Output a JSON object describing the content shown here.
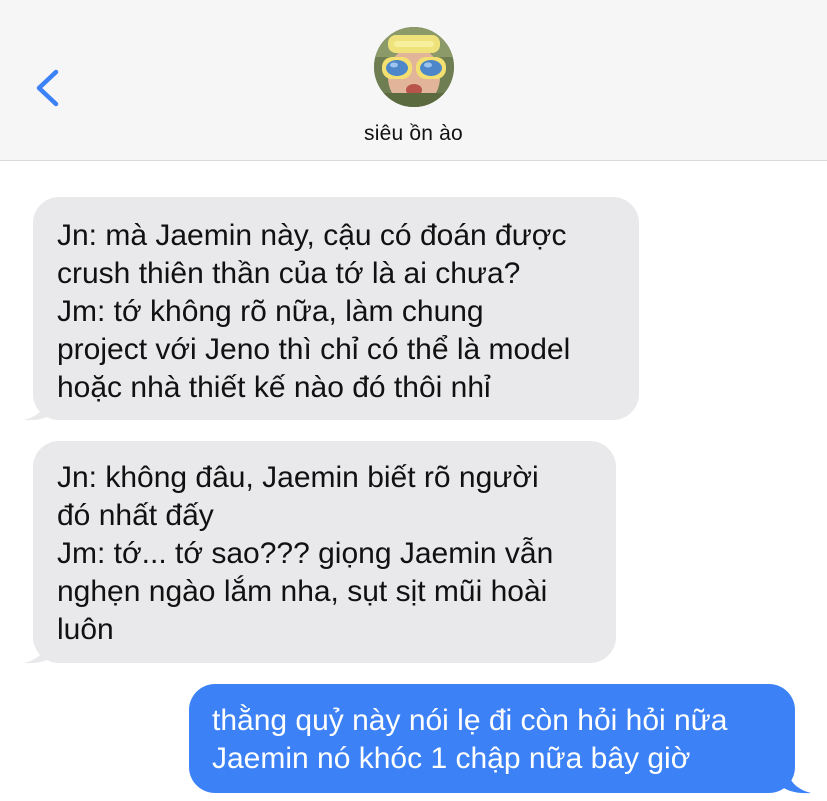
{
  "header": {
    "contact_name": "siêu ồn ào",
    "back_icon": "chevron-left-icon",
    "avatar": "contact-avatar"
  },
  "colors": {
    "header_bg": "#f6f6f6",
    "accent": "#3c82f6",
    "incoming_bubble": "#e9e9eb",
    "outgoing_bubble": "#3c82f6"
  },
  "messages": [
    {
      "direction": "incoming",
      "lines": [
        "Jn: mà Jaemin này, cậu có đoán được",
        "crush thiên thần của tớ là ai chưa?",
        "Jm: tớ không rõ nữa, làm chung",
        "project với Jeno thì chỉ có thể là model",
        "hoặc nhà thiết kế nào đó thôi nhỉ"
      ]
    },
    {
      "direction": "incoming",
      "lines": [
        "Jn: không đâu, Jaemin biết rõ người",
        "đó nhất đấy",
        "Jm: tớ... tớ sao??? giọng Jaemin vẫn",
        "nghẹn ngào lắm nha, sụt sịt mũi hoài",
        "luôn"
      ]
    },
    {
      "direction": "outgoing",
      "lines": [
        "thằng quỷ này nói lẹ đi còn hỏi hỏi nữa",
        "Jaemin nó khóc 1 chập nữa bây giờ"
      ]
    }
  ]
}
